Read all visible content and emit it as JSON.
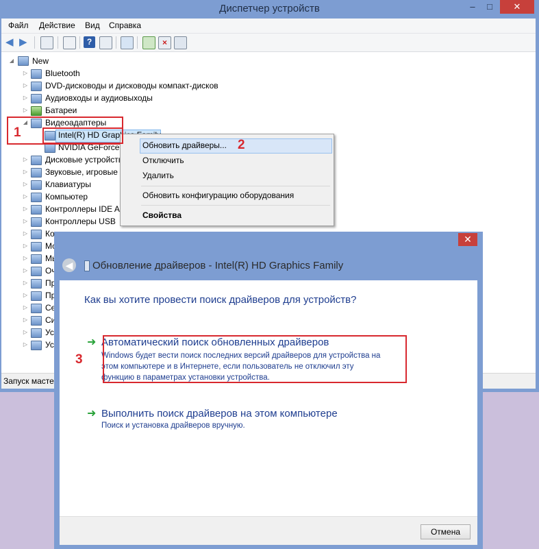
{
  "window": {
    "title": "Диспетчер устройств",
    "minimize": "–",
    "maximize": "□",
    "close": "✕"
  },
  "menu": [
    "Файл",
    "Действие",
    "Вид",
    "Справка"
  ],
  "tree": {
    "root": "New",
    "items": [
      "Bluetooth",
      "DVD-дисководы и дисководы компакт-дисков",
      "Аудиовходы и аудиовыходы",
      "Батареи",
      "Видеоадаптеры",
      "Intel(R) HD Graphics Family",
      "NVIDIA GeForce",
      "Дисковые устройств",
      "Звуковые, игровые",
      "Клавиатуры",
      "Компьютер",
      "Контроллеры IDE A",
      "Контроллеры USB",
      "Ко",
      "Мо",
      "Мы",
      "Оч",
      "Пр",
      "Пр",
      "Се",
      "Си",
      "Ус",
      "Ус"
    ]
  },
  "status_bar": "Запуск мастер",
  "context_menu": {
    "update": "Обновить драйверы...",
    "disable": "Отключить",
    "delete": "Удалить",
    "scan": "Обновить конфигурацию оборудования",
    "properties": "Свойства"
  },
  "dialog": {
    "title": "Обновление драйверов - Intel(R) HD Graphics Family",
    "close": "✕",
    "question": "Как вы хотите провести поиск драйверов для устройств?",
    "auto_title": "Автоматический поиск обновленных драйверов",
    "auto_desc_1": "Windows будет вести поиск последних версий драйверов для устройства на",
    "auto_desc_2": "этом компьютере и в Интернете, если пользователь не отключил эту",
    "auto_desc_3": "функцию в параметрах установки устройства.",
    "manual_title": "Выполнить поиск драйверов на этом компьютере",
    "manual_desc": "Поиск и установка драйверов вручную.",
    "cancel": "Отмена",
    "arrow": "➜"
  },
  "annotations": [
    "1",
    "2",
    "3"
  ],
  "colors": {
    "title_bar": "#7d9dd2",
    "annotation_red": "#d8282e",
    "link_blue": "#1e3d8f",
    "close_red": "#c7403b"
  }
}
